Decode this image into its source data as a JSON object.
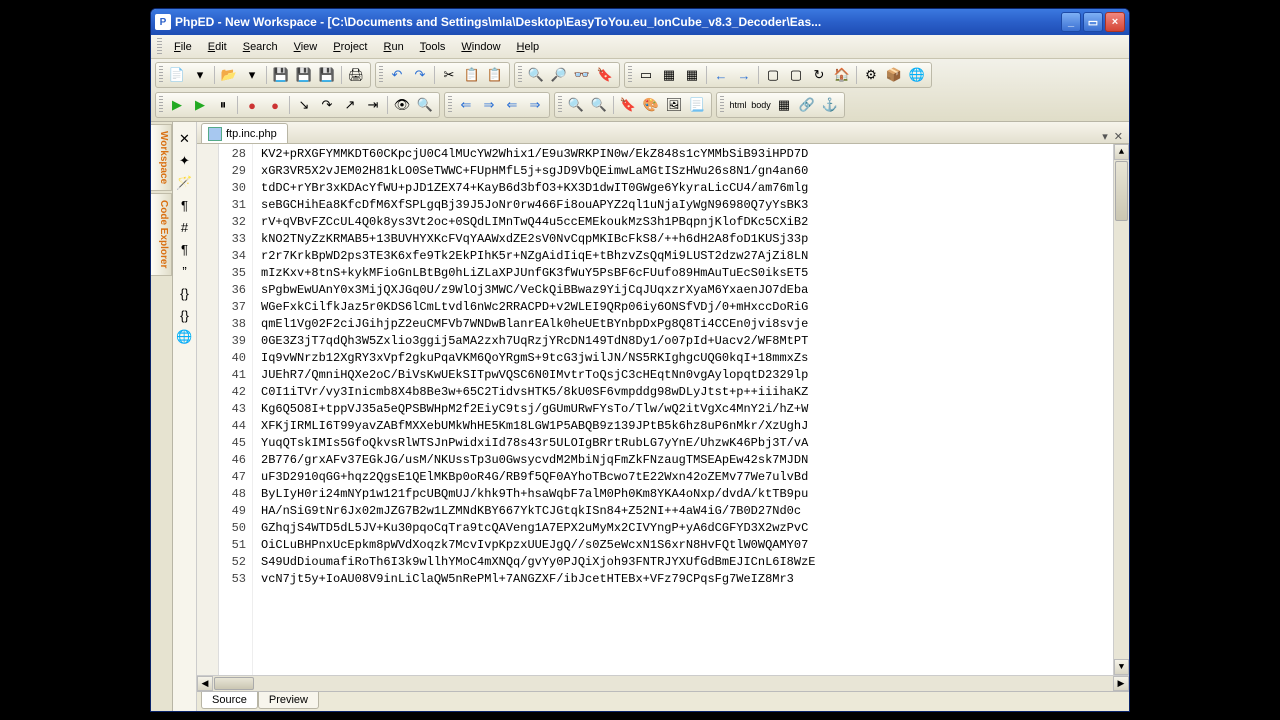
{
  "title": "PhpED - New Workspace - [C:\\Documents and Settings\\mla\\Desktop\\EasyToYou.eu_IonCube_v8.3_Decoder\\Eas...",
  "menu": {
    "file": "File",
    "edit": "Edit",
    "search": "Search",
    "view": "View",
    "project": "Project",
    "run": "Run",
    "tools": "Tools",
    "window": "Window",
    "help": "Help"
  },
  "sidebar": {
    "tab1": "Workspace",
    "tab2": "Code Explorer"
  },
  "file_tab": {
    "name": "ftp.inc.php"
  },
  "bottom_tabs": {
    "source": "Source",
    "preview": "Preview"
  },
  "lines": {
    "start": 28,
    "text": [
      "KV2+pRXGFYMMKDT60CKpcjU0C4lMUcYW2Whix1/E9u3WRKPIN0w/EkZ848s1cYMMbSiB93iHPD7D",
      "xGR3VR5X2vJEM02H81kLO0SeTWWC+FUpHMfL5j+sgJD9VbQEimwLaMGtISzHWu26s8N1/gn4an60",
      "tdDC+rYBr3xKDAcYfWU+pJD1ZEX74+KayB6d3bfO3+KX3D1dwIT0GWge6YkyraLicCU4/am76mlg",
      "seBGCHihEa8KfcDfM6XfSPLgqBj39J5JoNr0rw466Fi8ouAPYZ2ql1uNjaIyWgN96980Q7yYsBK3",
      "rV+qVBvFZCcUL4Q0k8ys3Vt2oc+0SQdLIMnTwQ44u5ccEMEkoukMzS3h1PBqpnjKlofDKc5CXiB2",
      "kNO2TNyZzKRMAB5+13BUVHYXKcFVqYAAWxdZE2sV0NvCqpMKIBcFkS8/++h6dH2A8foD1KUSj33p",
      "r2r7KrkBpWD2ps3TE3K6xfe9Tk2EkPIhK5r+NZgAidIiqE+tBhzvZsQqMi9LUST2dzw27AjZi8LN",
      "mIzKxv+8tnS+kykMFioGnLBtBg0hLiZLaXPJUnfGK3fWuY5PsBF6cFUufo89HmAuTuEcS0iksET5",
      "sPgbwEwUAnY0x3MijQXJGq0U/z9WlOj3MWC/VeCkQiBBwaz9YijCqJUqxzrXyaM6YxaenJO7dEba",
      "WGeFxkCilfkJaz5r0KDS6lCmLtvdl6nWc2RRACPD+v2WLEI9QRp06iy6ONSfVDj/0+mHxccDoRiG",
      "qmEl1Vg02F2ciJGihjpZ2euCMFVb7WNDwBlanrEAlk0heUEtBYnbpDxPg8Q8Ti4CCEn0jvi8svje",
      "0GE3Z3jT7qdQh3W5Zxlio3ggij5aMA2zxh7UqRzjYRcDN149TdN8Dy1/o07pId+Uacv2/WF8MtPT",
      "Iq9vWNrzb12XgRY3xVpf2gkuPqaVKM6QoYRgmS+9tcG3jwilJN/NS5RKIghgcUQG0kqI+18mmxZs",
      "JUEhR7/QmniHQXe2oC/BiVsKwUEkSITpwVQSC6N0IMvtrToQsjC3cHEqtNn0vgAylopqtD2329lp",
      "C0I1iTVr/vy3Inicmb8X4b8Be3w+65C2TidvsHTK5/8kU0SF6vmpddg98wDLyJtst+p++iiihaKZ",
      "Kg6Q5O8I+tppVJ35a5eQPSBWHpM2f2EiyC9tsj/gGUmURwFYsTo/Tlw/wQ2itVgXc4MnY2i/hZ+W",
      "XFKjIRMLI6T99yavZABfMXXebUMkWhHE5Km18LGW1P5ABQB9z139JPtB5k6hz8uP6nMkr/XzUghJ",
      "YuqQTskIMIs5GfoQkvsRlWTSJnPwidxiId78s43r5ULOIgBRrtRubLG7yYnE/UhzwK46Pbj3T/vA",
      "2B776/grxAFv37EGkJG/usM/NKUssTp3u0GwsycvdM2MbiNjqFmZkFNzaugTMSEApEw42sk7MJDN",
      "uF3D2910qGG+hqz2QgsE1QElMKBp0oR4G/RB9f5QF0AYhoTBcwo7tE22Wxn42oZEMv77We7ulvBd",
      "ByLIyH0ri24mNYp1w121fpcUBQmUJ/khk9Th+hsaWqbF7alM0Ph0Km8YKA4oNxp/dvdA/ktTB9pu",
      "HA/nSiG9tNr6Jx02mJZG7B2w1LZMNdKBY667YkTCJGtqkISn84+Z52NI++4aW4iG/7B0D27Nd0c",
      "GZhqjS4WTD5dL5JV+Ku30pqoCqTra9tcQAVeng1A7EPX2uMyMx2CIVYngP+yA6dCGFYD3X2wzPvC",
      "OiCLuBHPnxUcEpkm8pWVdXoqzk7McvIvpKpzxUUEJgQ//s0Z5eWcxN1S6xrN8HvFQtlW0WQAMY07",
      "S49UdDioumafiRoTh6I3k9wllhYMoC4mXNQq/gvYy0PJQiXjoh93FNTRJYXUfGdBmEJICnL6I8WzE",
      "vcN7jt5y+IoAU08V9inLiClaQW5nRePMl+7ANGZXF/ibJcetHTEBx+VFz79CPqsFg7WeIZ8Mr3"
    ]
  }
}
